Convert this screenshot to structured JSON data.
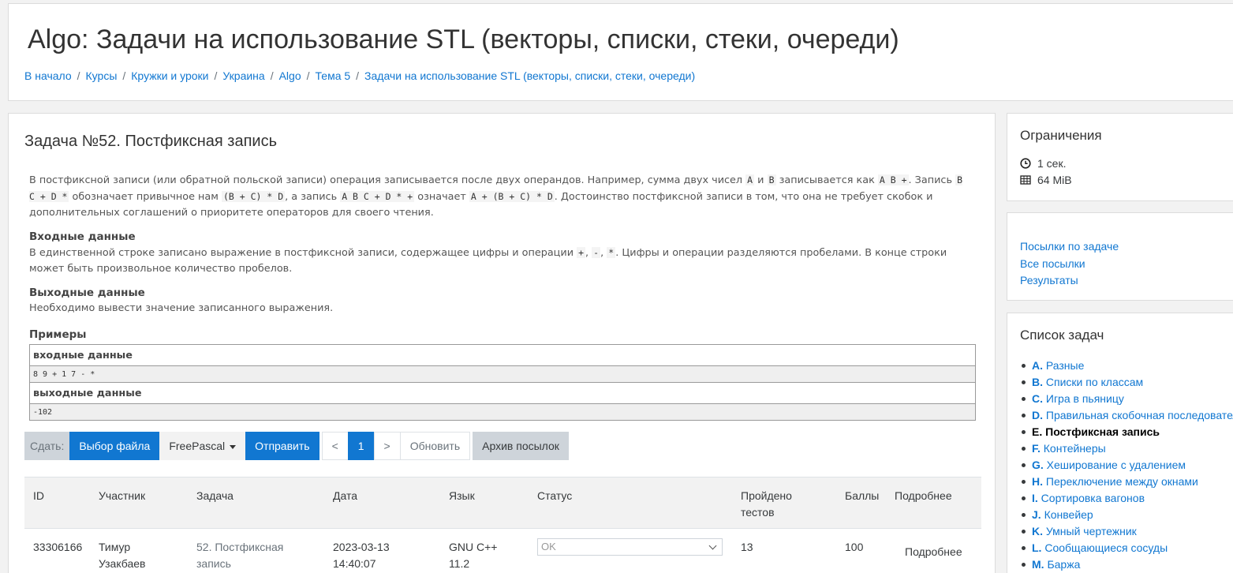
{
  "header": {
    "title": "Algo: Задачи на использование STL (векторы, списки, стеки, очереди)",
    "breadcrumb": [
      "В начало",
      "Курсы",
      "Кружки и уроки",
      "Украина",
      "Algo",
      "Тема 5",
      "Задачи на использование STL (векторы, списки, стеки, очереди)"
    ]
  },
  "task": {
    "title": "Задача №52. Постфиксная запись",
    "p1": [
      "В постфиксной записи (или обратной польской записи) операция записывается после двух операндов. Например, сумма двух чисел ",
      "A",
      " и ",
      "B",
      " записывается как ",
      "A B +",
      ". Запись ",
      "B C + D *",
      " обозначает привычное нам ",
      "(B + C) * D",
      ", а запись ",
      "A B C + D * +",
      " означает ",
      "A + (B + C) * D",
      ". Достоинство постфиксной записи в том, что она не требует скобок и дополнительных соглашений о приоритете операторов для своего чтения."
    ],
    "input_title": "Входные данные",
    "input_text": [
      "В единственной строке записано выражение в постфиксной записи, содержащее цифры и операции ",
      "+",
      ", ",
      "-",
      ", ",
      "*",
      ". Цифры и операции разделяются пробелами. В конце строки может быть произвольное количество пробелов."
    ],
    "output_title": "Выходные данные",
    "output_text": "Необходимо вывести значение записанного выражения.",
    "examples_title": "Примеры",
    "ex_input_label": "входные данные",
    "ex_input": "8 9 + 1 7 - *",
    "ex_output_label": "выходные данные",
    "ex_output": "-102"
  },
  "submit": {
    "label": "Сдать:",
    "choose_file": "Выбор файла",
    "language": "FreePascal",
    "send": "Отправить",
    "prev": "<",
    "page": "1",
    "next": ">",
    "refresh": "Обновить",
    "archive": "Архив посылок"
  },
  "submissions": {
    "headers": {
      "id": "ID",
      "user": "Участник",
      "task": "Задача",
      "date": "Дата",
      "lang": "Язык",
      "status": "Статус",
      "passed_1": "Пройдено",
      "passed_2": "тестов",
      "score": "Баллы",
      "details": "Подробнее"
    },
    "rows": [
      {
        "id": "33306166",
        "user_1": "Тимур",
        "user_2": "Узакбаев",
        "task_1": "52. Постфиксная",
        "task_2": "запись",
        "date_1": "2023-03-13",
        "date_2": "14:40:07",
        "lang_1": "GNU C++",
        "lang_2": "11.2",
        "status": "OK",
        "passed": "13",
        "score": "100",
        "details": "Подробнее"
      }
    ]
  },
  "limits": {
    "title": "Ограничения",
    "time": "1 сек.",
    "memory": "64 MiB"
  },
  "links": [
    "Посылки по задаче",
    "Все посылки",
    "Результаты"
  ],
  "tasklist": {
    "title": "Список задач",
    "items": [
      {
        "letter": "A.",
        "name": "Разные"
      },
      {
        "letter": "B.",
        "name": "Списки по классам"
      },
      {
        "letter": "C.",
        "name": "Игра в пьяницу"
      },
      {
        "letter": "D.",
        "name": "Правильная скобочная последовательность"
      },
      {
        "letter": "E.",
        "name": "Постфиксная запись"
      },
      {
        "letter": "F.",
        "name": "Контейнеры"
      },
      {
        "letter": "G.",
        "name": "Хеширование с удалением"
      },
      {
        "letter": "H.",
        "name": "Переключение между окнами"
      },
      {
        "letter": "I.",
        "name": "Сортировка вагонов"
      },
      {
        "letter": "J.",
        "name": "Конвейер"
      },
      {
        "letter": "K.",
        "name": "Умный чертежник"
      },
      {
        "letter": "L.",
        "name": "Сообщающиеся сосуды"
      },
      {
        "letter": "M.",
        "name": "Баржа"
      }
    ],
    "current_index": 4
  },
  "colors": {
    "link": "#1177d1",
    "primary": "#1177d1",
    "page_bg": "#f2f2f2"
  }
}
